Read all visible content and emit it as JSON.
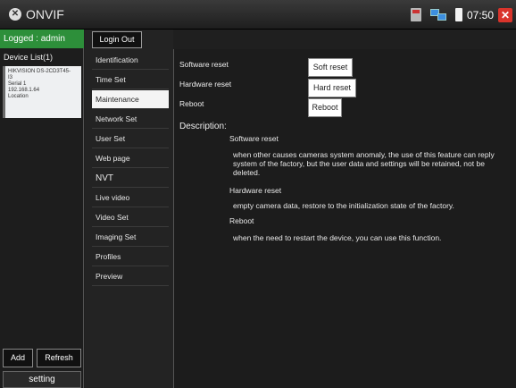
{
  "app": {
    "title": "ONVIF",
    "clock": "07:50"
  },
  "left": {
    "logged": "Logged : admin",
    "device_list_header": "Device List(1)",
    "device": {
      "name_line1": "HIKVISION DS-2CD3T45-",
      "name_line2": "I3",
      "serial": "Serial 1",
      "ip": "192.168.1.64",
      "location": "Location"
    },
    "add_label": "Add",
    "refresh_label": "Refresh",
    "setting_label": "setting"
  },
  "menu": {
    "login_out": "Login Out",
    "items": [
      {
        "label": "Identification"
      },
      {
        "label": "Time Set"
      },
      {
        "label": "Maintenance"
      },
      {
        "label": "Network Set"
      },
      {
        "label": "User Set"
      },
      {
        "label": "Web page"
      },
      {
        "label": "NVT"
      },
      {
        "label": "Live video"
      },
      {
        "label": "Video Set"
      },
      {
        "label": "Imaging Set"
      },
      {
        "label": "Profiles"
      },
      {
        "label": "Preview"
      }
    ],
    "active": "Maintenance"
  },
  "content": {
    "software_reset_label": "Software reset",
    "hardware_reset_label": "Hardware reset",
    "reboot_label": "Reboot",
    "soft_reset_btn": "Soft reset",
    "hard_reset_btn": "Hard reset",
    "reboot_btn": "Reboot",
    "description_header": "Description:",
    "desc": {
      "software_title": "Software reset",
      "software_text": "when other causes cameras system anomaly, the use of this feature can reply system of the factory, but the user data and settings will be retained, not be deleted.",
      "hardware_title": "Hardware reset",
      "hardware_text": "empty camera data, restore to the initialization state of the factory.",
      "reboot_title": "Reboot",
      "reboot_text": "when the need to restart the device, you can use this function."
    }
  }
}
